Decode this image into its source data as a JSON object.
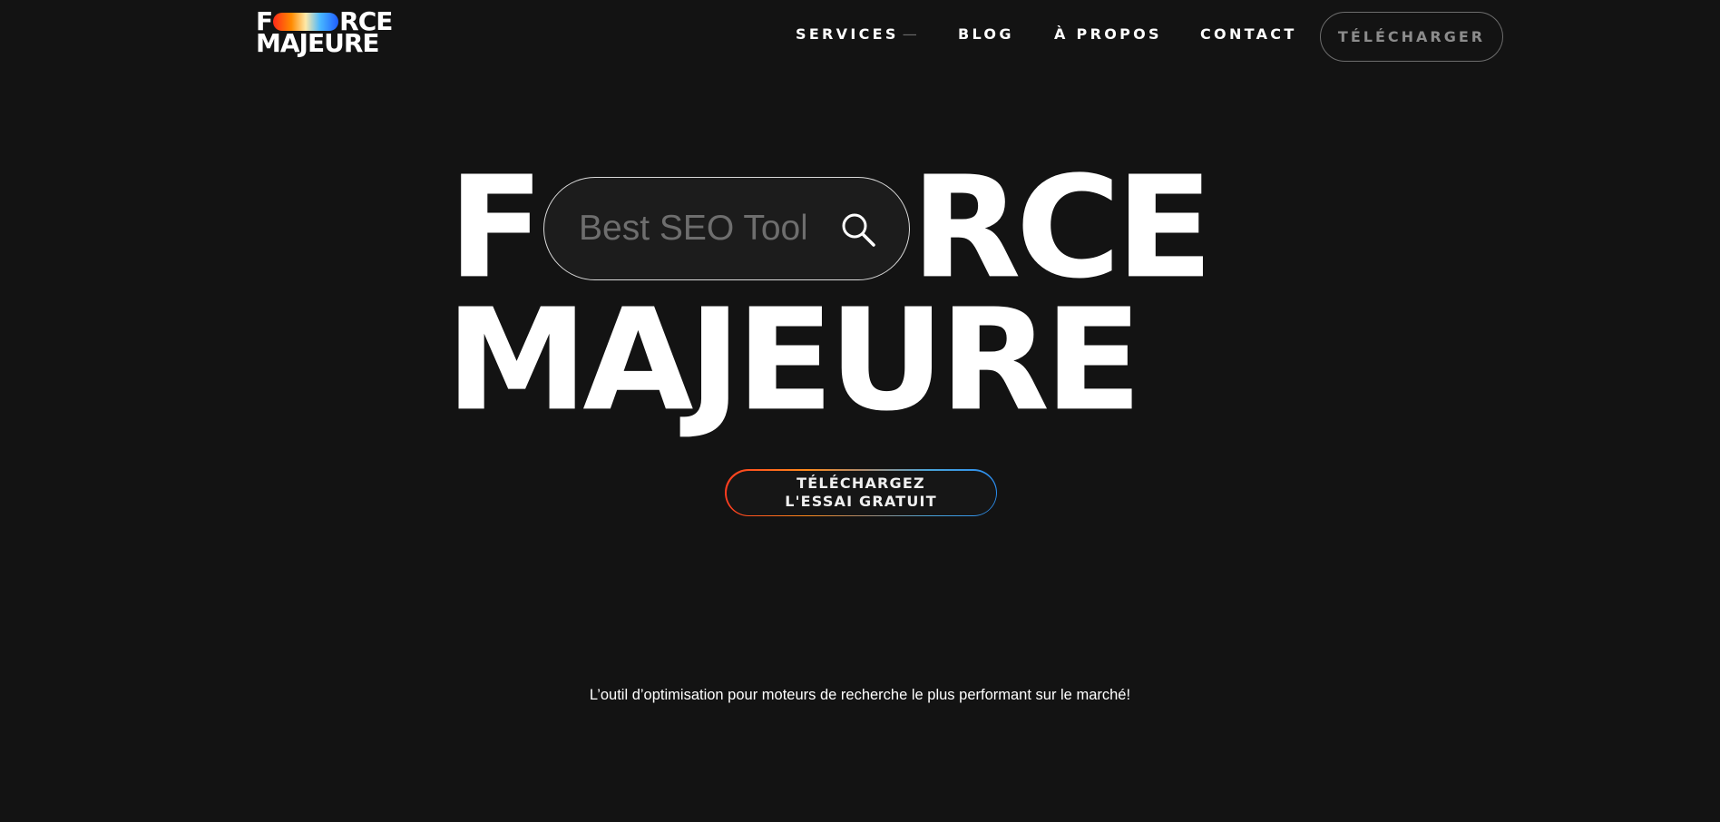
{
  "header": {
    "logo": {
      "line1_left": "F",
      "line1_right": "RCE",
      "line2": "MAJEURE"
    },
    "nav": {
      "services": "SERVICES",
      "services_suffix": "—",
      "blog": "BLOG",
      "apropos": "À PROPOS",
      "contact": "CONTACT"
    },
    "download_label": "TÉLÉCHARGER"
  },
  "hero": {
    "title_f": "F",
    "title_rce": "RCE",
    "title_line2": "MAJEURE",
    "search": {
      "placeholder": "Best SEO Tool",
      "value": ""
    },
    "cta": {
      "line1": "TÉLÉCHARGEZ",
      "line2": "L'ESSAI GRATUIT"
    },
    "tagline": "L’outil d’optimisation pour moteurs de recherche le plus performant sur le marché!"
  },
  "colors": {
    "background": "#131313",
    "text": "#ffffff",
    "muted": "#8c8c8c",
    "gradient_red": "#ff2a1a",
    "gradient_orange": "#ff8a00",
    "gradient_blue": "#1e5dff"
  }
}
